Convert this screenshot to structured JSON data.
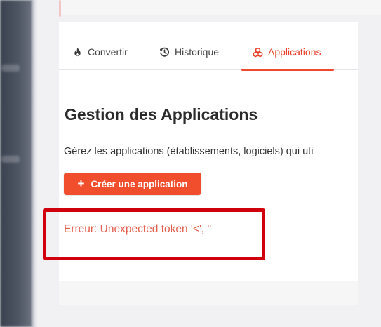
{
  "tabs": [
    {
      "label": "Convertir",
      "icon": "flame-icon",
      "active": false
    },
    {
      "label": "Historique",
      "icon": "history-icon",
      "active": false
    },
    {
      "label": "Applications",
      "icon": "applications-icon",
      "active": true
    }
  ],
  "main": {
    "title": "Gestion des Applications",
    "description": "Gérez les applications (établissements, logiciels) qui uti",
    "create_button_label": "Créer une application",
    "error_message": "Erreur: Unexpected token '<', \""
  },
  "colors": {
    "accent": "#ef4a2f",
    "button": "#f14e2e",
    "error_text": "#e35d4c",
    "highlight_border": "#d0000c"
  }
}
